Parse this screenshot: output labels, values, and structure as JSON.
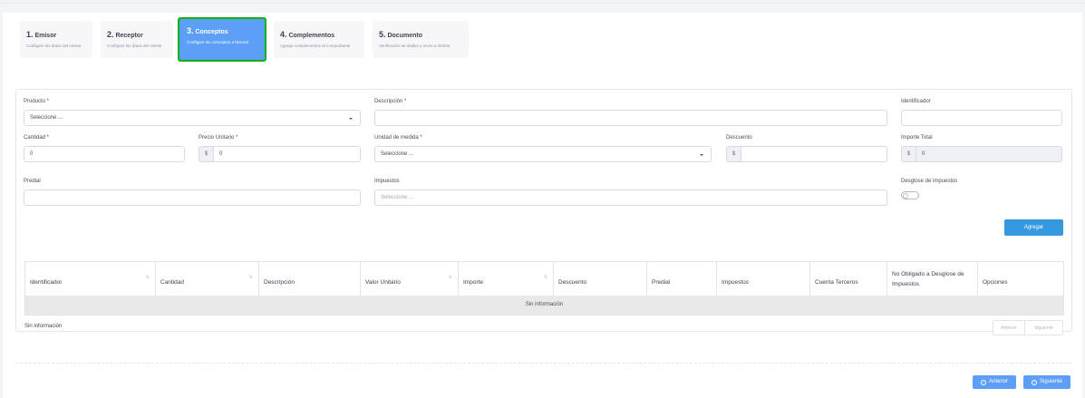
{
  "steps": [
    {
      "num": "1.",
      "title": "Emisor",
      "sub": "Configure los datos del emisor"
    },
    {
      "num": "2.",
      "title": "Receptor",
      "sub": "Configure los datos del cliente"
    },
    {
      "num": "3.",
      "title": "Conceptos",
      "sub": "Configure los conceptos a facturar"
    },
    {
      "num": "4.",
      "title": "Complementos",
      "sub": "Agrega complementos al comprobante"
    },
    {
      "num": "5.",
      "title": "Documento",
      "sub": "Verificación de totales y envío a timbrar"
    }
  ],
  "form": {
    "producto": {
      "label": "Producto *",
      "value": "Seleccione ..."
    },
    "descripcion": {
      "label": "Descripción *",
      "value": ""
    },
    "identificador": {
      "label": "Identificador",
      "value": ""
    },
    "cantidad": {
      "label": "Cantidad *",
      "value": "0"
    },
    "precio_unitario": {
      "label": "Precio Unitario *",
      "prefix": "$",
      "value": "0"
    },
    "unidad_medida": {
      "label": "Unidad de medida *",
      "value": "Seleccione ..."
    },
    "descuento": {
      "label": "Descuento",
      "prefix": "$",
      "value": ""
    },
    "importe_total": {
      "label": "Importe Total",
      "prefix": "$",
      "value": "0"
    },
    "predial": {
      "label": "Predial",
      "value": ""
    },
    "impuestos": {
      "label": "Impuestos",
      "placeholder": "Seleccione ..."
    },
    "desglose": {
      "label": "Desglose de impuestos",
      "on": false
    },
    "agregar_label": "Agregar"
  },
  "table": {
    "columns": [
      "Identificador",
      "Cantidad",
      "Descripción",
      "Valor Unitario",
      "Importe",
      "Descuento",
      "Predial",
      "Impuestos",
      "Cuenta Terceros",
      "No Obligado a Desglose de Impuestos",
      "Opciones"
    ],
    "empty_text": "Sin información"
  },
  "table_info": "Sin información",
  "pagination": {
    "prev": "Anterior",
    "next": "Siguiente"
  },
  "nav": {
    "prev": "Anterior",
    "next": "Siguiente"
  },
  "colors": {
    "accent": "#5d9ef7",
    "primary_button": "#3699e0",
    "active_outline": "#0fb30f"
  }
}
